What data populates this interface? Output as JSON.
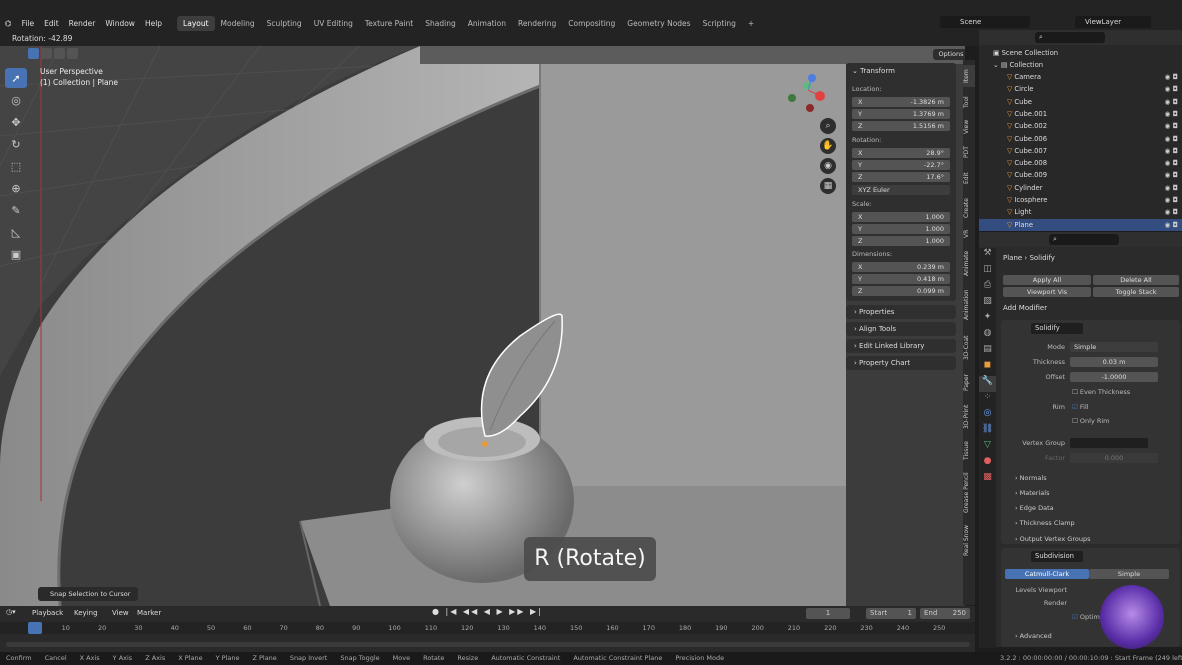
{
  "menus": [
    "File",
    "Edit",
    "Render",
    "Window",
    "Help"
  ],
  "workspaces": [
    "Layout",
    "Modeling",
    "Sculpting",
    "UV Editing",
    "Texture Paint",
    "Shading",
    "Animation",
    "Rendering",
    "Compositing",
    "Geometry Nodes",
    "Scripting",
    "+"
  ],
  "active_workspace": "Layout",
  "scene": "Scene",
  "view_layer": "ViewLayer",
  "header_status": "Rotation: -42.89",
  "viewport": {
    "perspective": "User Perspective",
    "collection_object": "(1) Collection | Plane",
    "options_label": "Options",
    "snap_panel": "Snap Selection to Cursor",
    "rotate_hint": "R (Rotate)"
  },
  "npanel": {
    "title": "Transform",
    "location_label": "Location:",
    "location": {
      "x": "-1.3826 m",
      "y": "1.3769 m",
      "z": "1.5156 m"
    },
    "rotation_label": "Rotation:",
    "rotation": {
      "x": "28.9°",
      "y": "-22.7°",
      "z": "17.6°"
    },
    "rotation_mode": "XYZ Euler",
    "scale_label": "Scale:",
    "scale": {
      "x": "1.000",
      "y": "1.000",
      "z": "1.000"
    },
    "dimensions_label": "Dimensions:",
    "dimensions": {
      "x": "0.239 m",
      "y": "0.418 m",
      "z": "0.099 m"
    },
    "axis": {
      "x": "X",
      "y": "Y",
      "z": "Z"
    },
    "sections": [
      "Properties",
      "Align Tools",
      "Edit Linked Library",
      "Property Chart"
    ]
  },
  "side_tabs": [
    "Item",
    "Tool",
    "View",
    "PDT",
    "Edit",
    "Create",
    "VR",
    "Animate",
    "Animation",
    "3D-Coat",
    "Paper",
    "3D-Print",
    "Tissue",
    "Grease Pencil",
    "Real Snow"
  ],
  "outliner": {
    "root": "Scene Collection",
    "collection": "Collection",
    "items": [
      "Camera",
      "Circle",
      "Cube",
      "Cube.001",
      "Cube.002",
      "Cube.006",
      "Cube.007",
      "Cube.008",
      "Cube.009",
      "Cylinder",
      "Icosphere",
      "Light",
      "Plane"
    ],
    "selected": "Plane"
  },
  "properties": {
    "breadcrumb_object": "Plane",
    "breadcrumb_modifier": "Solidify",
    "apply_all": "Apply All",
    "delete_all": "Delete All",
    "viewport_vis": "Viewport Vis",
    "toggle_stack": "Toggle Stack",
    "add_modifier": "Add Modifier",
    "solidify": {
      "name": "Solidify",
      "mode_label": "Mode",
      "mode": "Simple",
      "thickness_label": "Thickness",
      "thickness": "0.03 m",
      "offset_label": "Offset",
      "offset": "-1.0000",
      "even_thickness": "Even Thickness",
      "rim_label": "Rim",
      "fill": "Fill",
      "only_rim": "Only Rim",
      "vertex_group_label": "Vertex Group",
      "factor_label": "Factor",
      "factor": "0.000",
      "subpanels": [
        "Normals",
        "Materials",
        "Edge Data",
        "Thickness Clamp",
        "Output Vertex Groups"
      ]
    },
    "subdivision": {
      "name": "Subdivision",
      "catmull": "Catmull-Clark",
      "simple": "Simple",
      "levels_viewport": "Levels Viewport",
      "render": "Render",
      "optimal": "Optima",
      "advanced": "Advanced"
    }
  },
  "timeline": {
    "menus": [
      "Playback",
      "Keying",
      "View",
      "Marker"
    ],
    "current_frame": "1",
    "start_label": "Start",
    "start": "1",
    "end_label": "End",
    "end": "250",
    "ruler": [
      "1",
      "10",
      "20",
      "30",
      "40",
      "50",
      "60",
      "70",
      "80",
      "90",
      "100",
      "110",
      "120",
      "130",
      "140",
      "150",
      "160",
      "170",
      "180",
      "190",
      "200",
      "210",
      "220",
      "230",
      "240",
      "250"
    ]
  },
  "statusbar": {
    "items": [
      "Confirm",
      "Cancel",
      "X Axis",
      "Y Axis",
      "Z Axis",
      "X Plane",
      "Y Plane",
      "Z Plane",
      "Snap Invert",
      "Snap Toggle",
      "Move",
      "Rotate",
      "Resize",
      "Automatic Constraint",
      "Automatic Constraint Plane",
      "Precision Mode"
    ],
    "version": "3.2.2 : 00:00:00:00 / 00:00:10:09 : Start Frame (249 left)"
  },
  "colors": {
    "accent": "#4772b3",
    "selected_row": "#334d80",
    "orange": "#e89b3a",
    "green": "#5fba7d"
  }
}
